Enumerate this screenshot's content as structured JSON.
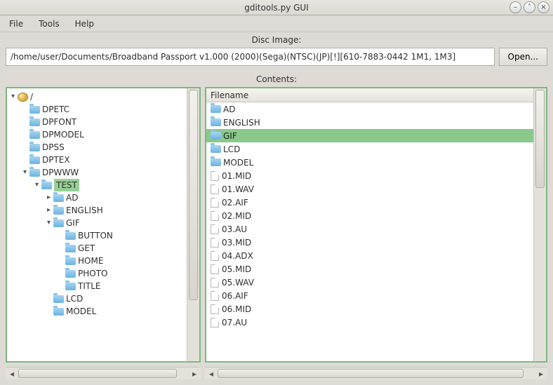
{
  "window": {
    "title": "gditools.py GUI"
  },
  "menu": {
    "file": "File",
    "tools": "Tools",
    "help": "Help"
  },
  "discImage": {
    "label": "Disc Image:",
    "value": "/home/user/Documents/Broadband Passport v1.000 (2000)(Sega)(NTSC)(JP)[!][610-7883-0442 1M1, 1M3]",
    "openLabel": "Open..."
  },
  "contents": {
    "label": "Contents:",
    "headerFilename": "Filename"
  },
  "tree": {
    "root": "/",
    "items": [
      {
        "name": "DPETC",
        "depth": 1,
        "kind": "folder",
        "expander": "none"
      },
      {
        "name": "DPFONT",
        "depth": 1,
        "kind": "folder",
        "expander": "none"
      },
      {
        "name": "DPMODEL",
        "depth": 1,
        "kind": "folder",
        "expander": "none"
      },
      {
        "name": "DPSS",
        "depth": 1,
        "kind": "folder",
        "expander": "none"
      },
      {
        "name": "DPTEX",
        "depth": 1,
        "kind": "folder",
        "expander": "none"
      },
      {
        "name": "DPWWW",
        "depth": 1,
        "kind": "folder",
        "expander": "open"
      },
      {
        "name": "TEST",
        "depth": 2,
        "kind": "folder",
        "expander": "open",
        "selected": true
      },
      {
        "name": "AD",
        "depth": 3,
        "kind": "folder",
        "expander": "closed"
      },
      {
        "name": "ENGLISH",
        "depth": 3,
        "kind": "folder",
        "expander": "closed"
      },
      {
        "name": "GIF",
        "depth": 3,
        "kind": "folder",
        "expander": "open"
      },
      {
        "name": "BUTTON",
        "depth": 4,
        "kind": "folder",
        "expander": "none"
      },
      {
        "name": "GET",
        "depth": 4,
        "kind": "folder",
        "expander": "none"
      },
      {
        "name": "HOME",
        "depth": 4,
        "kind": "folder",
        "expander": "none"
      },
      {
        "name": "PHOTO",
        "depth": 4,
        "kind": "folder",
        "expander": "none"
      },
      {
        "name": "TITLE",
        "depth": 4,
        "kind": "folder",
        "expander": "none"
      },
      {
        "name": "LCD",
        "depth": 3,
        "kind": "folder",
        "expander": "none"
      },
      {
        "name": "MODEL",
        "depth": 3,
        "kind": "folder",
        "expander": "none"
      }
    ]
  },
  "filelist": {
    "items": [
      {
        "name": "AD",
        "kind": "folder"
      },
      {
        "name": "ENGLISH",
        "kind": "folder"
      },
      {
        "name": "GIF",
        "kind": "folder",
        "selected": true
      },
      {
        "name": "LCD",
        "kind": "folder"
      },
      {
        "name": "MODEL",
        "kind": "folder"
      },
      {
        "name": "01.MID",
        "kind": "file"
      },
      {
        "name": "01.WAV",
        "kind": "file"
      },
      {
        "name": "02.AIF",
        "kind": "file"
      },
      {
        "name": "02.MID",
        "kind": "file"
      },
      {
        "name": "03.AU",
        "kind": "file"
      },
      {
        "name": "03.MID",
        "kind": "file"
      },
      {
        "name": "04.ADX",
        "kind": "file"
      },
      {
        "name": "05.MID",
        "kind": "file"
      },
      {
        "name": "05.WAV",
        "kind": "file"
      },
      {
        "name": "06.AIF",
        "kind": "file"
      },
      {
        "name": "06.MID",
        "kind": "file"
      },
      {
        "name": "07.AU",
        "kind": "file"
      }
    ]
  }
}
